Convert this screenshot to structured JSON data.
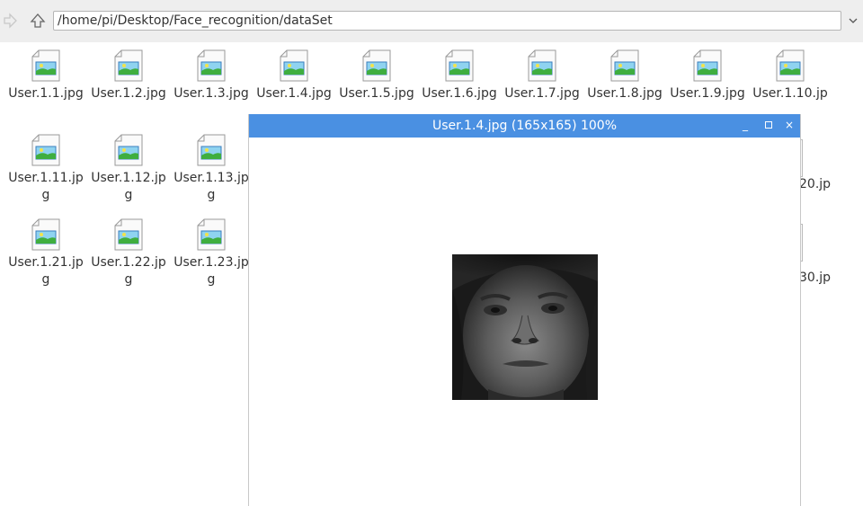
{
  "toolbar": {
    "path": "/home/pi/Desktop/Face_recognition/dataSet",
    "forward_icon": "arrow-right-icon",
    "up_icon": "arrow-up-icon",
    "dropdown_icon": "chevron-down-icon"
  },
  "files": [
    {
      "label": "User.1.1.jpg"
    },
    {
      "label": "User.1.2.jpg"
    },
    {
      "label": "User.1.3.jpg"
    },
    {
      "label": "User.1.4.jpg"
    },
    {
      "label": "User.1.5.jpg"
    },
    {
      "label": "User.1.6.jpg"
    },
    {
      "label": "User.1.7.jpg"
    },
    {
      "label": "User.1.8.jpg"
    },
    {
      "label": "User.1.9.jpg"
    },
    {
      "label": "User.1.10.jp"
    },
    {
      "label": "User.1.11.jpg"
    },
    {
      "label": "User.1.12.jpg"
    },
    {
      "label": "User.1.13.jpg"
    },
    {
      "label": "User.1.21.jpg"
    },
    {
      "label": "User.1.22.jpg"
    },
    {
      "label": "User.1.23.jpg"
    }
  ],
  "partial_labels": {
    "row2_right": "20.jp",
    "row3_right": "30.jp"
  },
  "viewer": {
    "title": "User.1.4.jpg (165x165) 100%",
    "minimize": "_",
    "maximize": "□",
    "close": "×",
    "titlebar_color": "#4a90e2"
  }
}
